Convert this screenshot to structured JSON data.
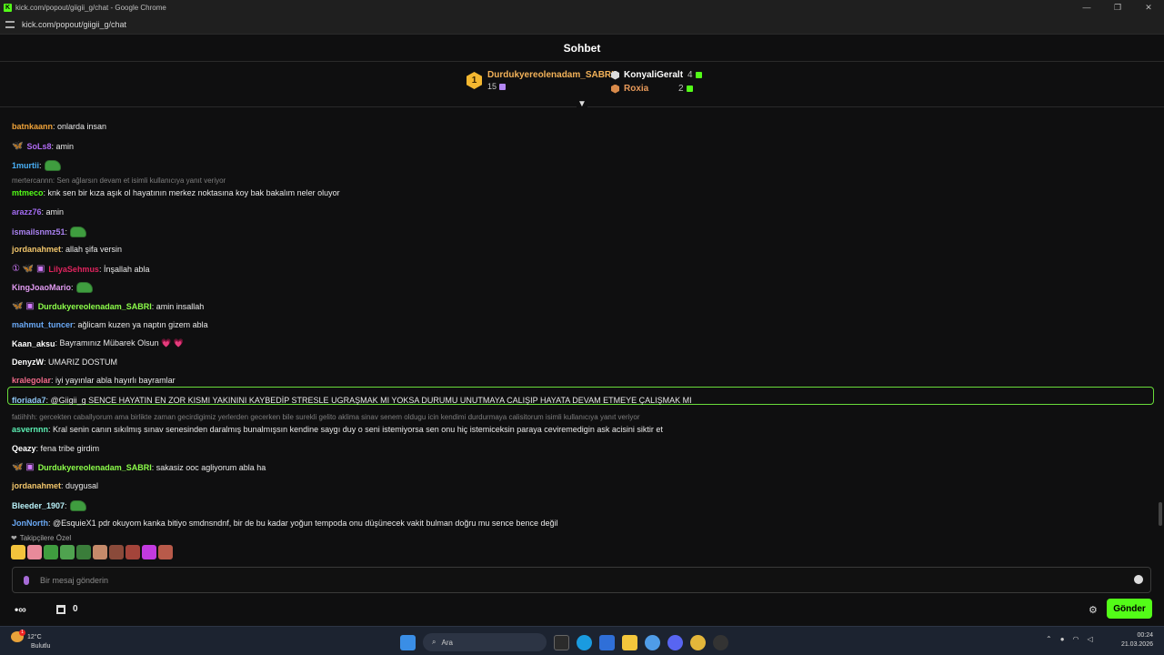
{
  "window": {
    "title": "kick.com/popout/giigii_g/chat - Google Chrome",
    "url": "kick.com/popout/giigii_g/chat",
    "controls": [
      "—",
      "❐",
      "✕"
    ]
  },
  "header": {
    "title": "Sohbet"
  },
  "leaderboard": {
    "first": {
      "rank": "1",
      "name": "Durdukyereolenadam_SABRI",
      "count": "15"
    },
    "second": {
      "name": "KonyaliGeralt",
      "count": "4"
    },
    "third": {
      "name": "Roxia",
      "count": "2"
    }
  },
  "messages": [
    {
      "user": "batnkaann",
      "color": "#f0a339",
      "text": ": onlarda insan"
    },
    {
      "user": "SoLs8",
      "color": "#b06bf2",
      "text": ": amin",
      "badges": "🦋"
    },
    {
      "user": "1murtii",
      "color": "#49b0f7",
      "text": ":",
      "emote": true
    },
    {
      "reply": "mertercannn: Sen ağlarsın devam et isimli kullanıcıya yanıt veriyor"
    },
    {
      "user": "mtmeco",
      "color": "#53fc18",
      "text": ": knk sen bir kıza aşık ol hayatının merkez noktasına koy bak bakalım neler oluyor"
    },
    {
      "user": "arazz76",
      "color": "#a36cf2",
      "text": ": amin"
    },
    {
      "user": "ismailsnmz51",
      "color": "#a981f0",
      "text": ":",
      "emote": true
    },
    {
      "user": "jordanahmet",
      "color": "#f2c66b",
      "text": ": allah şifa versin"
    },
    {
      "user": "LilyaSehmus",
      "color": "#e0245e",
      "text": ": İnşallah abla",
      "badges": "① 🦋 ▣"
    },
    {
      "user": "KingJoaoMario",
      "color": "#e29bf2",
      "text": ":",
      "emote": true
    },
    {
      "user": "Durdukyereolenadam_SABRI",
      "color": "#8cff4a",
      "text": ": amin insallah",
      "badges": "🦋 ▣"
    },
    {
      "user": "mahmut_tuncer",
      "color": "#6aa9f5",
      "text": ": ağlicam kuzen ya naptın gizem abla"
    },
    {
      "user": "Kaan_aksu",
      "color": "#ffffff",
      "text": ": Bayramınız Mübarek Olsun 💗 💗"
    },
    {
      "user": "DenyzW",
      "color": "#ffffff",
      "text": ": UMARIZ DOSTUM"
    },
    {
      "user": "kralegolar",
      "color": "#f26b8a",
      "text": ": iyi yayınlar abla hayırlı bayramlar"
    },
    {
      "user": "floriada7",
      "color": "#8ec7f5",
      "text": ": @Giigii_g SENCE HAYATIN EN ZOR KISMI YAKININI KAYBEDİP STRESLE UGRAŞMAK MI YOKSA DURUMU UNUTMAYA CALIŞIP HAYATA DEVAM ETMEYE ÇALIŞMAK MI"
    },
    {
      "reply": "fatiihhh: gercekten caballyorum ama birlikte zaman gecirdigimiz yerlerden gecerken bile surekli gelito aklima sinav senem oldugu icin kendimi durdurmaya calisitorum isimli kullanıcıya yanıt veriyor"
    },
    {
      "user": "asvernnn",
      "color": "#5cf2b5",
      "text": ": Kral senin canın sıkılmış sınav senesinden daralmış bunalmışsın kendine saygı duy o seni istemiyorsa sen onu hiç istemiceksin paraya ceviremedigin ask acisini siktir et"
    },
    {
      "user": "Qeazy",
      "color": "#ffffff",
      "text": ": fena tribe girdim"
    },
    {
      "user": "Durdukyereolenadam_SABRI",
      "color": "#8cff4a",
      "text": ": sakasiz ooc agliyorum abla ha",
      "badges": "🦋 ▣"
    },
    {
      "user": "jordanahmet",
      "color": "#f2c66b",
      "text": ": duygusal"
    },
    {
      "user": "Bleeder_1907",
      "color": "#b8f0f7",
      "text": ":",
      "emote": true
    },
    {
      "user": "JonNorth",
      "color": "#6aa9f5",
      "text": ": @EsquieX1 pdr okuyom kanka bitiyo smdnsndnf, bir de bu kadar yoğun tempoda onu düşünecek vakit bulman doğru mu sence bence değil"
    }
  ],
  "emote_strip": {
    "label": "Takipçilere Özel",
    "count": 10
  },
  "input": {
    "placeholder": "Bir mesaj gönderin"
  },
  "bottom": {
    "store_count": "0",
    "send_label": "Gönder"
  },
  "taskbar": {
    "temp": "12°C",
    "weather": "Bulutlu",
    "search": "Ara",
    "time": "00:24",
    "date": "21.03.2026"
  },
  "colors": {
    "accent": "#53fc18",
    "bg": "#0f0f10"
  }
}
